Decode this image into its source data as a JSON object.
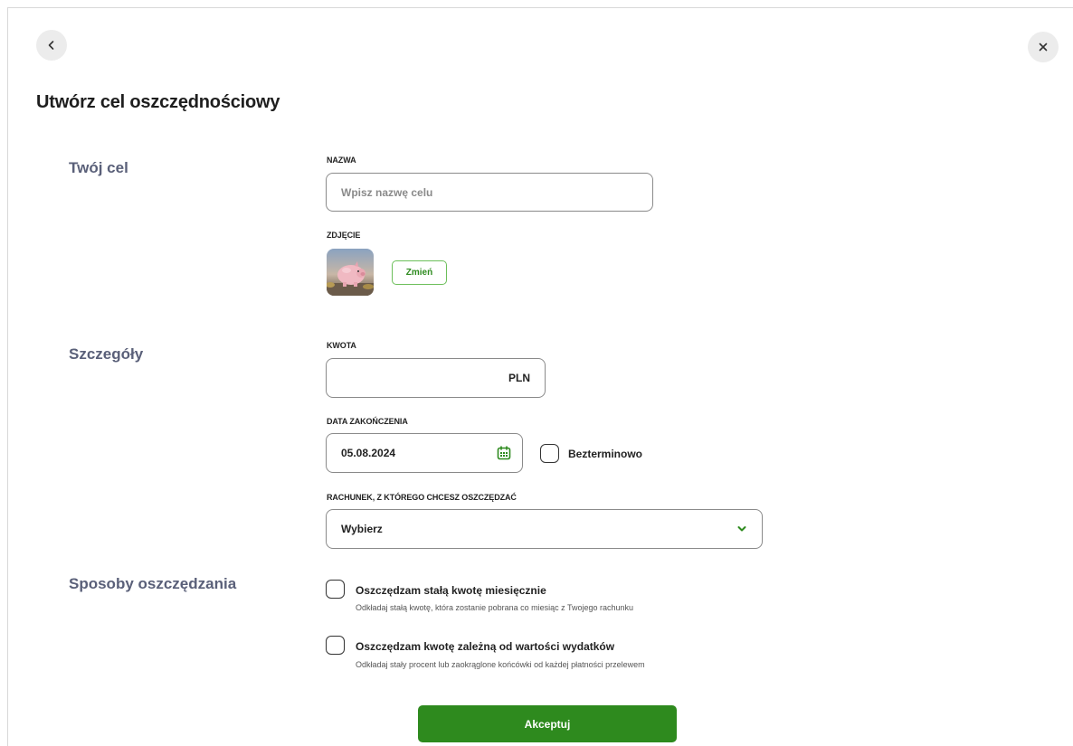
{
  "header": {
    "title": "Utwórz cel oszczędnościowy",
    "back_icon": "chevron-left-icon",
    "close_icon": "close-icon"
  },
  "sections": {
    "goal": "Twój cel",
    "details": "Szczegóły",
    "methods": "Sposoby oszczędzania"
  },
  "goal": {
    "name_label": "NAZWA",
    "name_value": "",
    "name_placeholder": "Wpisz nazwę celu",
    "photo_label": "ZDJĘCIE",
    "change_button": "Zmień"
  },
  "details": {
    "amount_label": "KWOTA",
    "amount_value": "",
    "currency": "PLN",
    "end_date_label": "DATA ZAKOŃCZENIA",
    "end_date_value": "05.08.2024",
    "indefinite_label": "Bezterminowo",
    "indefinite_checked": false,
    "account_label": "RACHUNEK, Z KTÓREGO CHCESZ OSZCZĘDZAĆ",
    "account_value": "Wybierz"
  },
  "methods": [
    {
      "title": "Oszczędzam stałą kwotę miesięcznie",
      "description": "Odkładaj stałą kwotę, która zostanie pobrana co miesiąc z Twojego rachunku",
      "checked": false
    },
    {
      "title": "Oszczędzam kwotę zależną od wartości wydatków",
      "description": "Odkładaj stały procent lub zaokrąglone końcówki od każdej płatności przelewem",
      "checked": false
    }
  ],
  "footer": {
    "accept_button": "Akceptuj"
  },
  "colors": {
    "accent": "#2e8a1e",
    "section_label": "#5a6079"
  }
}
